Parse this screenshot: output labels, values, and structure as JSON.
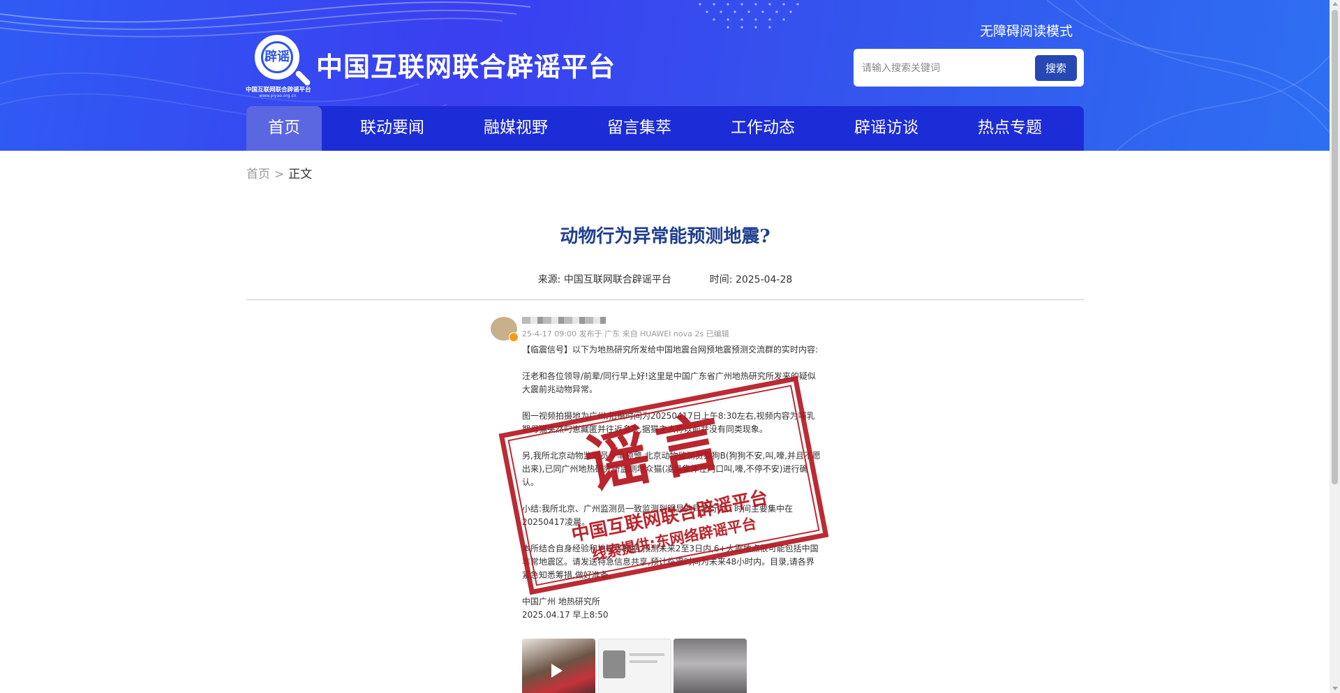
{
  "header": {
    "logo_text": "辟谣",
    "logo_subtitle": "中国互联网联合辟谣平台",
    "logo_url": "www.piyao.org.cn",
    "site_title": "中国互联网联合辟谣平台",
    "accessible_mode": "无障碍阅读模式",
    "search": {
      "placeholder": "请输入搜索关键词",
      "button_label": "搜索"
    }
  },
  "nav": {
    "items": [
      {
        "label": "首页",
        "active": true
      },
      {
        "label": "联动要闻",
        "active": false
      },
      {
        "label": "融媒视野",
        "active": false
      },
      {
        "label": "留言集萃",
        "active": false
      },
      {
        "label": "工作动态",
        "active": false
      },
      {
        "label": "辟谣访谈",
        "active": false
      },
      {
        "label": "热点专题",
        "active": false
      }
    ]
  },
  "breadcrumb": {
    "home": "首页",
    "separator": ">",
    "current": "正文"
  },
  "article": {
    "title": "动物行为异常能预测地震?",
    "source_label": "来源:",
    "source": "中国互联网联合辟谣平台",
    "time_label": "时间:",
    "time": "2025-04-28"
  },
  "post_image": {
    "meta": "25-4-17 09:00 发布于 广东 来自 HUAWEI nova 2s 已编辑",
    "paragraphs": [
      "【临震信号】以下为地热研究所发给中国地震台网预地震预测交流群的实时内容:",
      "汪老和各位领导/前辈/同行早上好!这里是中国广东省广州地热研究所发来的疑似大震前兆动物异常。",
      "图一视频拍摄地为广州,拍摄时间为20250417日上午8:30左右,视频内容为哺乳期母猫突然叼崽藏匿并往返多次,据猫主人称以前并没有同类现象。",
      "另,我所北京动物监测员今早预警,北京动物监测员猫狗B(狗狗不安,叫,嚎,并且不愿出来),已同广州地热研究所监测地众猫(凌晨集体在门口叫,嚎,不停不安)进行确认。",
      "小结:我所北京、广州监测员一致监测到明显的异常行为。时间主要集中在20250417凌晨。",
      "本所结合自身经验和地磁等数据,预测未来2至3日内,6+大震地点很可能包括中国非常地震区。请发送特急信息共享,预计临震时间为未来48小时内。目录,请各界紧急知悉筹措,做好准备。",
      "中国广州 地热研究所",
      "2025.04.17 早上8:50"
    ],
    "stamp_big": "谣言",
    "stamp_line1": "中国互联网联合辟谣平台",
    "stamp_line2": "线索提供:东网络辟谣平台"
  },
  "colors": {
    "header_blue": "#3a3ff0",
    "nav_bg": "#1c2cd6",
    "title_blue": "#1f3f8f",
    "search_button": "#2648b4",
    "stamp_red": "#b4141d"
  }
}
